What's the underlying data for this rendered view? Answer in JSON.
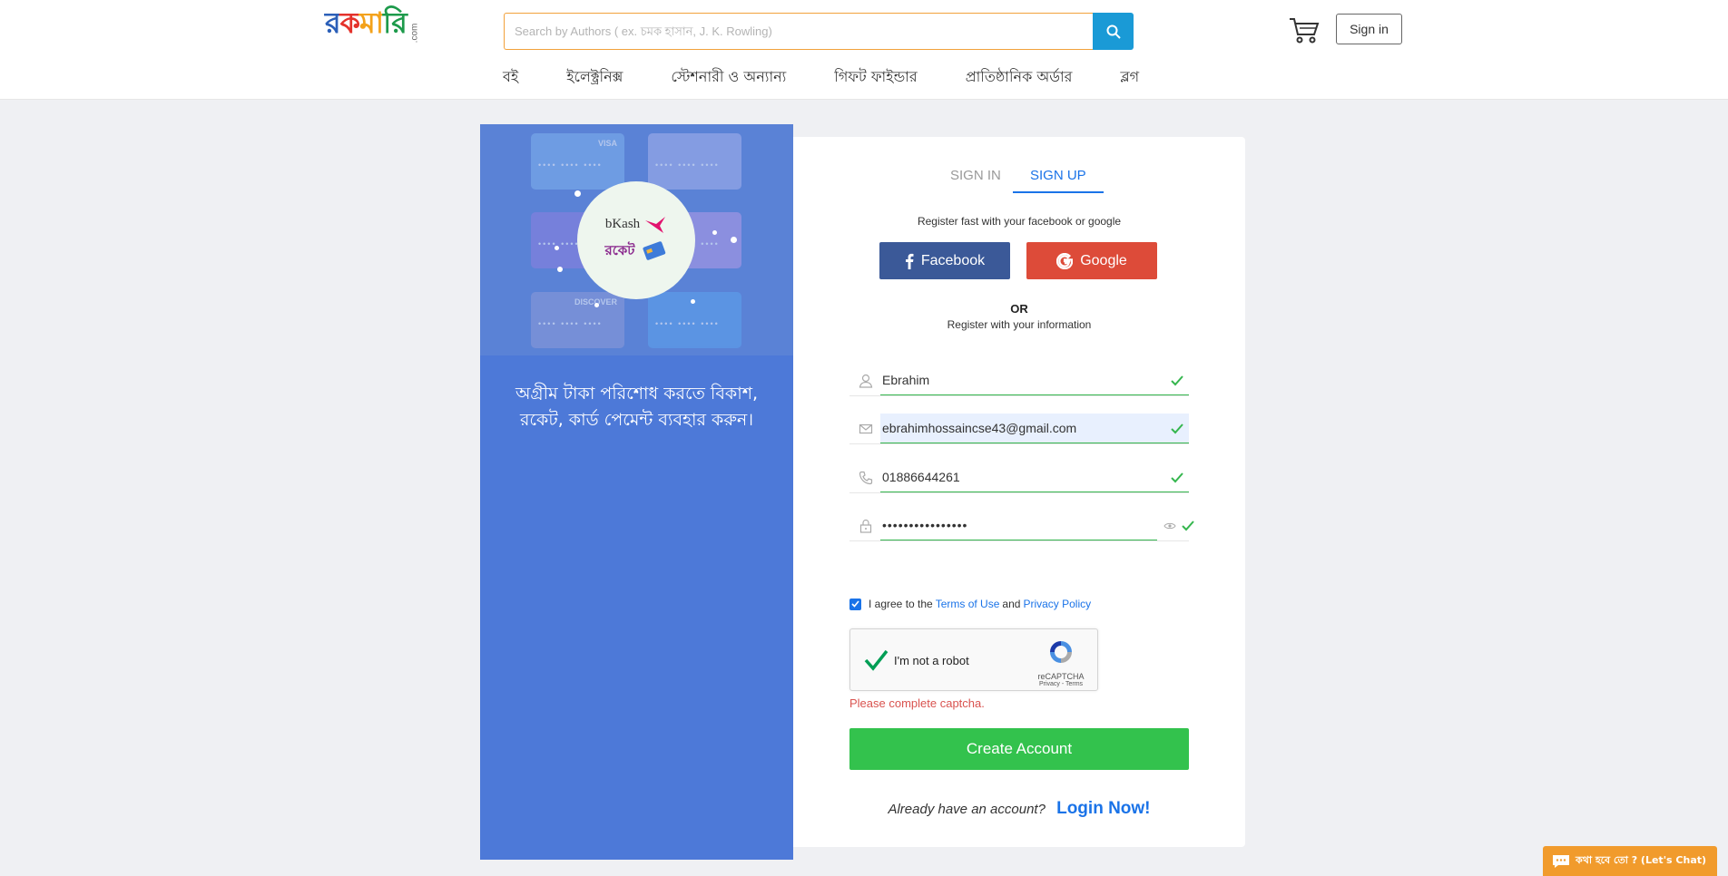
{
  "header": {
    "logo_text": [
      "র",
      "ক",
      "মা",
      "রি"
    ],
    "logo_suffix": ".com",
    "search_placeholder": "Search by Authors ( ex. চমক হাসান, J. K. Rowling)",
    "signin_label": "Sign in",
    "nav": [
      "বই",
      "ইলেক্ট্রনিক্স",
      "স্টেশনারী ও অন্যান্য",
      "গিফট ফাইন্ডার",
      "প্রাতিষ্ঠানিক অর্ডার",
      "ব্লগ"
    ]
  },
  "promo": {
    "bkash_label": "bKash",
    "rocket_label": "রকেট",
    "text": "অগ্রীম টাকা পরিশোধ করতে বিকাশ, রকেট, কার্ড পেমেন্ট ব্যবহার করুন।",
    "cards": [
      {
        "brand": "VISA",
        "color": "#7fb2ef"
      },
      {
        "brand": "",
        "color": "#a7b2ec"
      },
      {
        "brand": "",
        "color": "#8e7fe0"
      },
      {
        "brand": "",
        "color": "#b49be8"
      },
      {
        "brand": "DISCOVER",
        "color": "#8e9bd8"
      },
      {
        "brand": "",
        "color": "#5da3ee"
      }
    ]
  },
  "auth": {
    "tab_signin": "SIGN IN",
    "tab_signup": "SIGN UP",
    "fast_text": "Register fast with your facebook or google",
    "facebook_label": "Facebook",
    "google_label": "Google",
    "or_text": "OR",
    "register_info": "Register with your information",
    "name_value": "Ebrahim",
    "email_value": "ebrahimhossaincse43@gmail.com",
    "phone_value": "01886644261",
    "password_value": "••••••••••••••••",
    "agree_prefix": "I agree to the",
    "terms_label": "Terms of Use",
    "and_text": "and",
    "privacy_label": "Privacy Policy",
    "captcha_text": "I'm not a robot",
    "captcha_brand": "reCAPTCHA",
    "captcha_links": "Privacy - Terms",
    "captcha_error": "Please complete captcha.",
    "create_label": "Create Account",
    "already_text": "Already have an account?",
    "login_label": "Login Now!"
  },
  "chat": {
    "label": "কথা হবে তো ? (Let's Chat)"
  },
  "colors": {
    "accent": "#1a73e8",
    "success": "#35b64e",
    "facebook": "#3b5998",
    "google": "#dd4b39",
    "promo_bg": "#4d79d8",
    "chat": "#f19b2c"
  }
}
